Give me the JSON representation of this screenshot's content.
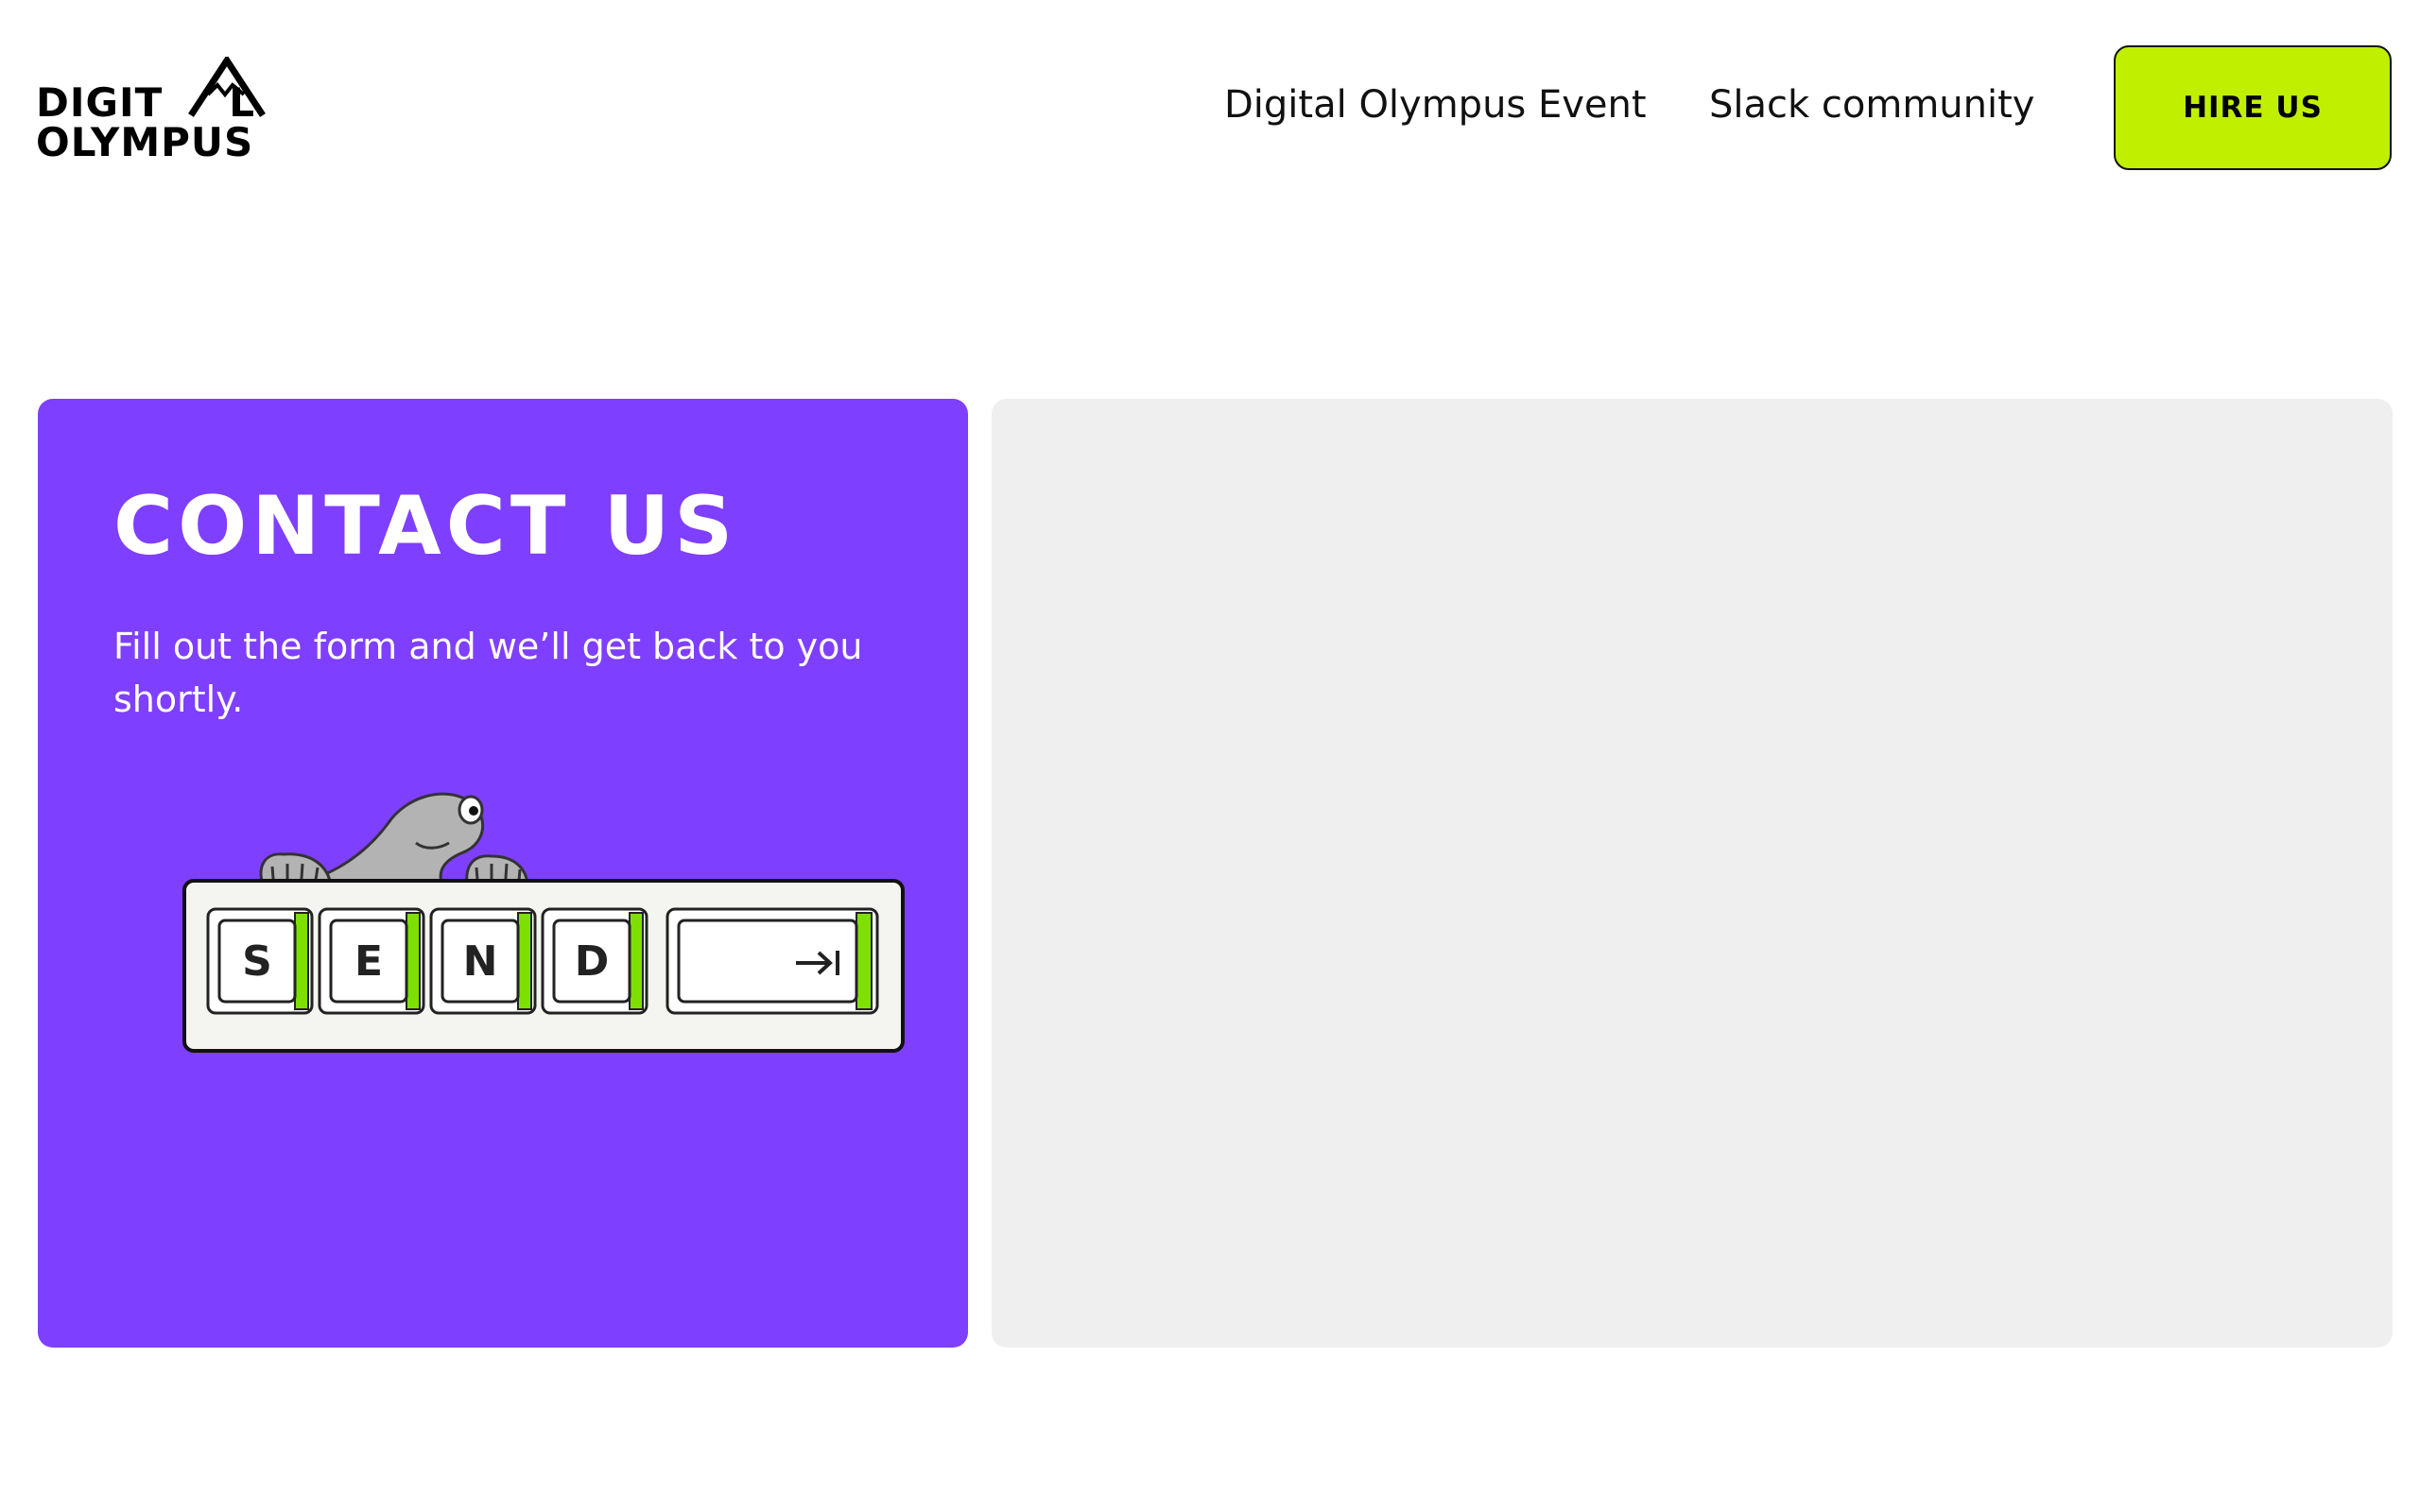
{
  "header": {
    "logo": {
      "line1": "DIGIT",
      "line1_end": "L",
      "line2": "OLYMPUS",
      "icon": "mountain-peak-icon"
    },
    "nav": {
      "event_label": "Digital Olympus Event",
      "slack_label": "Slack community"
    },
    "hire_button_label": "HIRE US"
  },
  "contact": {
    "title": "CONTACT US",
    "subtitle": "Fill out the form and we’ll get back to you shortly.",
    "illustration": {
      "keys": [
        "S",
        "E",
        "N",
        "D"
      ],
      "enter_key_icon": "arrow-right-to-bar-icon",
      "character": "seal-character-icon"
    }
  },
  "colors": {
    "accent_green": "#c0f000",
    "key_green": "#7ee000",
    "card_purple": "#7f3fff",
    "panel_gray": "#efefef"
  }
}
